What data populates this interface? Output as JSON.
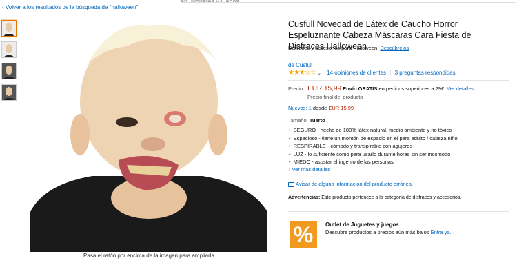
{
  "nav": {
    "back_link": "‹ Volver a los resultados de la búsqueda de \"halloween\""
  },
  "top_strip": "en Juguetes y juegos",
  "gallery": {
    "caption": "Pasa el ratón por encima de la imagen para ampliarla"
  },
  "product": {
    "title": "Cusfull Novedad de Látex de Caucho Horror Espeluznante Cabeza Máscaras Cara Fiesta de Disfraces Halloween",
    "category_text": "Disfraces y accesorios para Halloween.",
    "category_link": "Descúbrelos",
    "brand": "de Cusfull",
    "stars": "★★★☆☆",
    "reviews": "14 opiniones de clientes",
    "questions": "3 preguntas respondidas",
    "price_label": "Precio:",
    "price": "EUR 15,99",
    "shipping_bold": "Envío GRATIS",
    "shipping_text": " en pedidos superiores a 29€.",
    "shipping_link": "Ver detalles",
    "final_price": "Precio final del producto",
    "new_link": "Nuevos: 1",
    "new_from": " desde ",
    "new_price": "EUR 15,99",
    "size_label": "Tamaño:",
    "size_value": "Tuerto",
    "bullets": [
      "SEGURO - hecha de 100% látex natural, medio ambiente y no tóxico",
      "Espacioso - tiene un montón de espacio en él para adulto / cabeza niño",
      "RESPIRABLE - cómodo y transpirable con agujeros",
      "LUZ - lo suficiente como para usarlo durante horas sin ser incómodo",
      "MIEDO - asustar el ingenio de las personas"
    ],
    "more_details": "› Ver más detalles",
    "report": "Avisar de alguna información del producto errónea.",
    "warning_label": "Advertencias:",
    "warning_text": " Este producto pertenece a la categoría de disfraces y accesorios."
  },
  "outlet": {
    "icon_glyph": "%",
    "title": "Outlet de Juguetes y juegos",
    "desc": "Descubre productos a precios aún más bajos ",
    "link": "Entra ya."
  },
  "colors": {
    "link": "#0066c0",
    "price": "#b12704",
    "star": "#f0a500",
    "outlet": "#f29a1f"
  }
}
